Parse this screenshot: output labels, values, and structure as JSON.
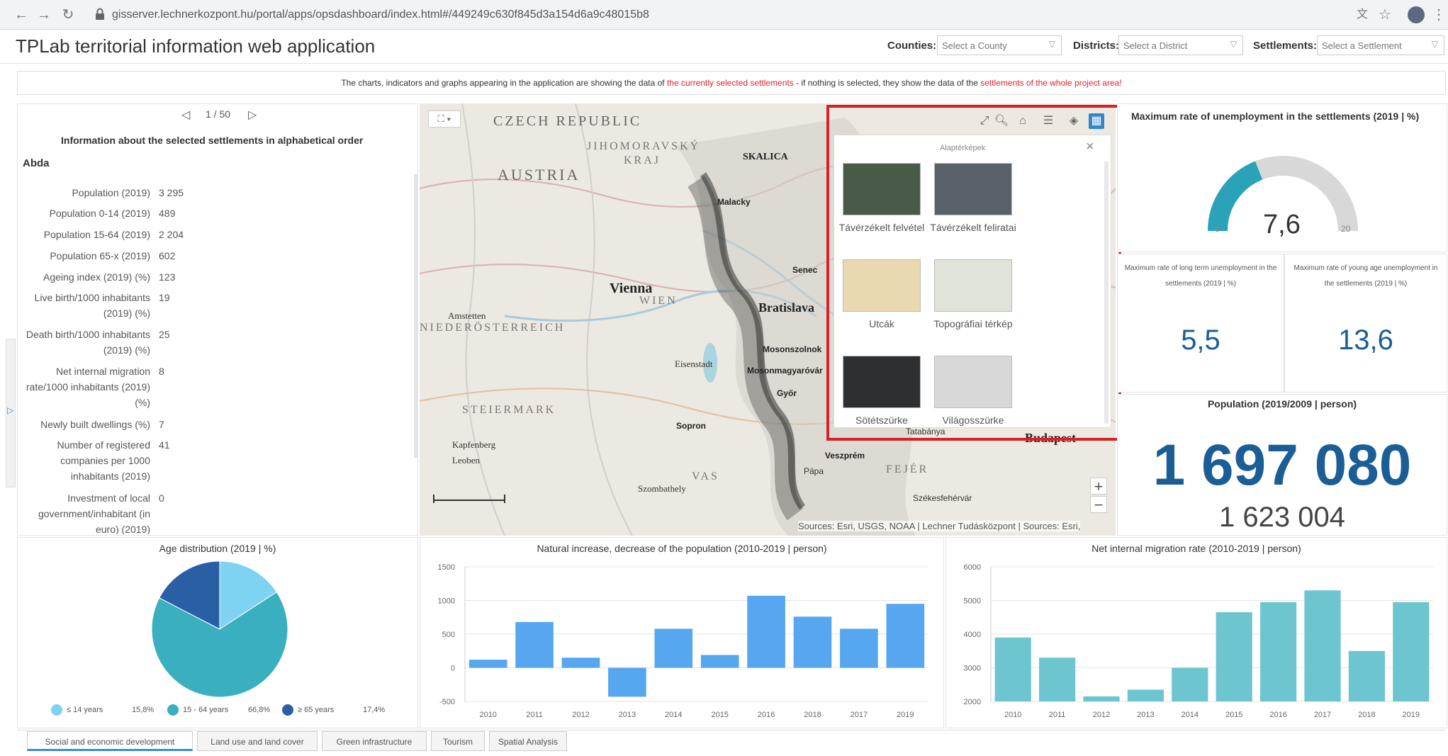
{
  "browser": {
    "url": "gisserver.lechnerkozpont.hu/portal/apps/opsdashboard/index.html#/449249c630f845d3a154d6a9c48015b8"
  },
  "header": {
    "title": "TPLab territorial information web application",
    "filters": [
      {
        "label": "Counties:",
        "placeholder": "Select a County"
      },
      {
        "label": "Districts:",
        "placeholder": "Select a District"
      },
      {
        "label": "Settlements:",
        "placeholder": "Select a Settlement"
      }
    ]
  },
  "notice": {
    "part1": "The charts, indicators and graphs appearing in the application are showing the data of ",
    "red1": "the currently selected settlements",
    "part2": " - if nothing is selected, they show the data of the ",
    "red2": "settlements of the whole project area!"
  },
  "info_list": {
    "pager": "1 / 50",
    "heading": "Information about the selected settlements in alphabetical order",
    "settlement": "Abda",
    "stats": [
      {
        "label": "Population (2019)",
        "value": "3 295"
      },
      {
        "label": "Population 0-14 (2019)",
        "value": "489"
      },
      {
        "label": "Population 15-64 (2019)",
        "value": "2 204"
      },
      {
        "label": "Population 65-x (2019)",
        "value": "602"
      },
      {
        "label": "Ageing index (2019) (%)",
        "value": "123"
      },
      {
        "label": "Live birth/1000 inhabitants (2019) (%)",
        "value": "19"
      },
      {
        "label": "Death birth/1000 inhabitants (2019) (%)",
        "value": "25"
      },
      {
        "label": "Net internal migration rate/1000 inhabitants (2019) (%)",
        "value": "8"
      },
      {
        "label": "Newly built dwellings (%)",
        "value": "7"
      },
      {
        "label": "Number of registered companies per 1000 inhabitants (2019)",
        "value": "41"
      },
      {
        "label": "Investment of local government/inhabitant (in euro) (2019)",
        "value": "0"
      }
    ]
  },
  "map": {
    "labels": {
      "czech": "CZECH REPUBLIC",
      "jihomoravsky": "JIHOMORAVSKÝ",
      "kraj": "KRAJ",
      "austria": "AUSTRIA",
      "vienna": "Vienna",
      "wien": "WIEN",
      "niederosterreich": "NIEDERÖSTERREICH",
      "steiermark": "STEIERMARK",
      "vas": "VAS",
      "fejer": "FEJÉR",
      "bratislava": "Bratislava",
      "budapest": "Budapest",
      "skalica": "SKALICA",
      "eisenstadt": "Eisenstadt",
      "amstetten": "Amstetten",
      "leoben": "Leoben",
      "szombathely": "Szombathely",
      "kapfenberg": "Kapfenberg",
      "mosonmagyarovar": "Mosonmagyaróvár",
      "tatabanya": "Tatabánya",
      "veszprem": "Veszprém",
      "papa": "Pápa",
      "szekesfehervar": "Székesfehérvár",
      "mosonszolnok": "Mosonszolnok",
      "gyor": "Győr",
      "sopron": "Sopron",
      "malacky": "Malacky",
      "senec": "Senec"
    },
    "attribution": "Sources: Esri, USGS, NOAA | Lechner Tudásközpont | Sources: Esri,",
    "zoom_in": "+",
    "zoom_out": "−"
  },
  "gallery": {
    "title": "Alaptérképek",
    "items": [
      {
        "label": "Távérzékelt felvétel",
        "color": "#4a5a48"
      },
      {
        "label": "Távérzékelt feliratai",
        "color": "#5a6168"
      },
      {
        "label": "Utcák",
        "color": "#e8d9b0"
      },
      {
        "label": "Topográfiai térkép",
        "color": "#dfe3da"
      },
      {
        "label": "Sötétszürke",
        "color": "#2e2f31"
      },
      {
        "label": "Világosszürke",
        "color": "#d8d8d8"
      }
    ]
  },
  "indicators": {
    "gauge": {
      "title": "Maximum rate of unemployment in the settlements (2019 | %)",
      "value": "7,6",
      "min": "0",
      "max": "20",
      "fraction": 0.38
    },
    "long_term": {
      "title": "Maximum rate of long term unemployment in the settlements (2019 | %)",
      "value": "5,5"
    },
    "young_age": {
      "title": "Maximum rate of young age unemployment in the settlements (2019 | %)",
      "value": "13,6"
    },
    "population": {
      "title": "Population (2019/2009 | person)",
      "current": "1 697 080",
      "previous": "1 623 004"
    }
  },
  "charts_titles": {
    "pie": "Age distribution (2019 | %)",
    "bar1": "Natural increase, decrease of the population (2010-2019 | person)",
    "bar2": "Net internal migration rate (2010-2019 | person)"
  },
  "pie_legend": [
    {
      "label": "≤ 14 years",
      "value": "15,8%",
      "color": "#7fd3f2"
    },
    {
      "label": "15 - 64 years",
      "value": "66,8%",
      "color": "#3aafbf"
    },
    {
      "label": "≥ 65 years",
      "value": "17,4%",
      "color": "#2a5fa5"
    }
  ],
  "chart_data": [
    {
      "type": "pie",
      "title": "Age distribution (2019 | %)",
      "categories": [
        "≤ 14 years",
        "15 - 64 years",
        "≥ 65 years"
      ],
      "values": [
        15.8,
        66.8,
        17.4
      ]
    },
    {
      "type": "bar",
      "title": "Natural increase, decrease of the population (2010-2019 | person)",
      "categories": [
        "2010",
        "2011",
        "2012",
        "2013",
        "2014",
        "2015",
        "2016",
        "2018",
        "2017",
        "2019"
      ],
      "values": [
        120,
        680,
        150,
        -430,
        580,
        190,
        1070,
        760,
        580,
        950
      ],
      "ylim": [
        -500,
        1500
      ],
      "yticks": [
        "1500",
        "1000",
        "500",
        "0",
        "-500"
      ],
      "grid": true,
      "color": "#56a6f0"
    },
    {
      "type": "bar",
      "title": "Net internal migration rate (2010-2019 | person)",
      "categories": [
        "2010",
        "2011",
        "2012",
        "2013",
        "2014",
        "2015",
        "2016",
        "2017",
        "2018",
        "2019"
      ],
      "values": [
        3900,
        3300,
        2150,
        2350,
        3000,
        4650,
        4950,
        5300,
        3500,
        4950
      ],
      "ylim": [
        2000,
        6000
      ],
      "yticks": [
        "6000",
        "5000",
        "4000",
        "3000",
        "2000"
      ],
      "grid": true,
      "color": "#6cc5cf"
    }
  ],
  "tabs": [
    "Social and economic development",
    "Land use and land cover",
    "Green infrastructure",
    "Tourism",
    "Spatial Analysis"
  ]
}
